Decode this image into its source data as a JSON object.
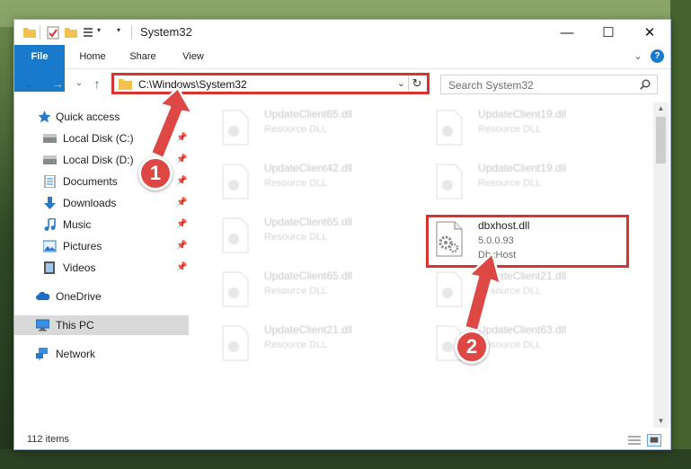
{
  "window": {
    "title": "System32",
    "controls": {
      "minimize": "—",
      "maximize": "☐",
      "close": "✕"
    }
  },
  "ribbon": {
    "tabs": [
      "File",
      "Home",
      "Share",
      "View"
    ],
    "expand": "⌄",
    "help": "?"
  },
  "nav": {
    "back": "←",
    "forward": "→",
    "recent": "⌄",
    "up": "↑",
    "address": "C:\\Windows\\System32",
    "address_dropdown": "⌄",
    "refresh": "↻",
    "search_placeholder": "Search System32"
  },
  "sidebar": {
    "items": [
      {
        "label": "Quick access",
        "icon": "star-icon",
        "pinned": false
      },
      {
        "label": "Local Disk (C:)",
        "icon": "drive-icon",
        "pinned": true
      },
      {
        "label": "Local Disk (D:)",
        "icon": "drive-icon",
        "pinned": true
      },
      {
        "label": "Documents",
        "icon": "documents-icon",
        "pinned": true
      },
      {
        "label": "Downloads",
        "icon": "downloads-icon",
        "pinned": true
      },
      {
        "label": "Music",
        "icon": "music-icon",
        "pinned": true
      },
      {
        "label": "Pictures",
        "icon": "pictures-icon",
        "pinned": true
      },
      {
        "label": "Videos",
        "icon": "videos-icon",
        "pinned": true
      },
      {
        "label": "OneDrive",
        "icon": "onedrive-icon",
        "pinned": false
      },
      {
        "label": "This PC",
        "icon": "pc-icon",
        "pinned": false,
        "selected": true
      },
      {
        "label": "Network",
        "icon": "network-icon",
        "pinned": false
      }
    ],
    "pin_glyph": "📌"
  },
  "files": [
    {
      "name": "UpdateClient65.dll",
      "type": "Resource DLL"
    },
    {
      "name": "UpdateClient19.dll",
      "type": "Resource DLL"
    },
    {
      "name": "UpdateClient42.dll",
      "type": "Resource DLL"
    },
    {
      "name": "UpdateClient19.dll",
      "type": "Resource DLL"
    },
    {
      "name": "UpdateClient65.dll",
      "type": "Resource DLL"
    },
    {
      "name": "dbxhost.dll",
      "version": "5.0.0.93",
      "desc": "DbxHost",
      "highlighted": true
    },
    {
      "name": "UpdateClient65.dll",
      "type": "Resource DLL"
    },
    {
      "name": "UpdateClient21.dll",
      "type": "Resource DLL"
    },
    {
      "name": "UpdateClient21.dll",
      "type": "Resource DLL"
    },
    {
      "name": "UpdateClient63.dll",
      "type": "Resource DLL"
    }
  ],
  "status": {
    "count": "112 items"
  },
  "annotations": {
    "step1": "1",
    "step2": "2"
  },
  "colors": {
    "accent": "#1979ca",
    "highlight": "#d9322f",
    "badge": "#dd4744"
  }
}
